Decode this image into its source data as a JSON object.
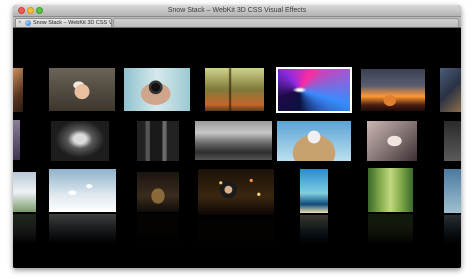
{
  "window": {
    "title": "Snow Stack – WebKit 3D CSS Visual Effects"
  },
  "tabs": [
    {
      "label": "Snow Stack – WebKit 3D CSS Visu...",
      "favicon": "safari-compass-icon"
    }
  ],
  "stage": {
    "background": "#000000",
    "selected_photo": "row1-col6"
  }
}
